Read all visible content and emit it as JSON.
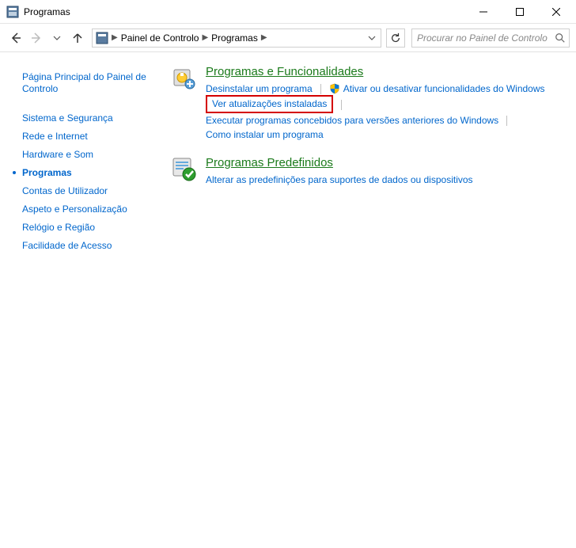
{
  "window": {
    "title": "Programas"
  },
  "address": {
    "crumb1": "Painel de Controlo",
    "crumb2": "Programas"
  },
  "search": {
    "placeholder": "Procurar no Painel de Controlo"
  },
  "sidebar": {
    "home": "Página Principal do Painel de Controlo",
    "items": [
      "Sistema e Segurança",
      "Rede e Internet",
      "Hardware e Som",
      "Programas",
      "Contas de Utilizador",
      "Aspeto e Personalização",
      "Relógio e Região",
      "Facilidade de Acesso"
    ],
    "currentIndex": 3
  },
  "sections": {
    "prog_func": {
      "title": "Programas e Funcionalidades",
      "tasks": {
        "uninstall": "Desinstalar um programa",
        "features": "Ativar ou desativar funcionalidades do Windows",
        "updates": "Ver atualizações instaladas",
        "compat": "Executar programas concebidos para versões anteriores do Windows",
        "howto": "Como instalar um programa"
      }
    },
    "defaults": {
      "title": "Programas Predefinidos",
      "tasks": {
        "change": "Alterar as predefinições para suportes de dados ou dispositivos"
      }
    }
  }
}
